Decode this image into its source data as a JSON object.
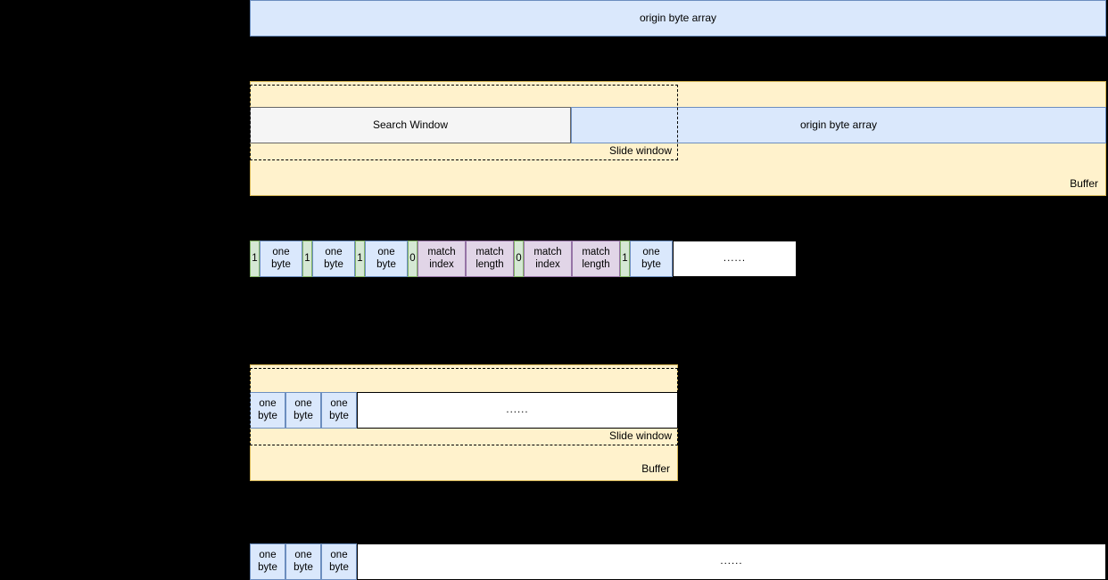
{
  "diagram": {
    "title": "LZ77 sliding window compression diagram",
    "colors": {
      "background": "#000000",
      "blue_fill": "#dae8fc",
      "blue_stroke": "#6c8ebf",
      "buffer_fill": "#fff2cc",
      "buffer_stroke": "#d6b656",
      "gray_fill": "#f5f5f5",
      "gray_stroke": "#666666",
      "purple_fill": "#e1d5e7",
      "purple_stroke": "#9673a6",
      "green_fill": "#d5e8d4",
      "green_stroke": "#82b366",
      "white_fill": "#ffffff",
      "dash_stroke": "#000000"
    }
  },
  "section1": {
    "origin_label": "origin byte array"
  },
  "section2": {
    "search_window_label": "Search Window",
    "origin_label": "origin byte array",
    "slide_window_label": "Slide window",
    "buffer_label": "Buffer"
  },
  "section3": {
    "cells": [
      {
        "kind": "flag",
        "text": "1"
      },
      {
        "kind": "byte",
        "text": "one\nbyte"
      },
      {
        "kind": "flag",
        "text": "1"
      },
      {
        "kind": "byte",
        "text": "one\nbyte"
      },
      {
        "kind": "flag",
        "text": "1"
      },
      {
        "kind": "byte",
        "text": "one\nbyte"
      },
      {
        "kind": "flag",
        "text": "0"
      },
      {
        "kind": "match",
        "text": "match\nindex"
      },
      {
        "kind": "match",
        "text": "match\nlength"
      },
      {
        "kind": "flag",
        "text": "0"
      },
      {
        "kind": "match",
        "text": "match\nindex"
      },
      {
        "kind": "match",
        "text": "match\nlength"
      },
      {
        "kind": "flag",
        "text": "1"
      },
      {
        "kind": "byte",
        "text": "one\nbyte"
      },
      {
        "kind": "tail",
        "text": "......"
      }
    ]
  },
  "section4": {
    "bytes": [
      "one\nbyte",
      "one\nbyte",
      "one\nbyte"
    ],
    "tail_text": "......",
    "slide_window_label": "Slide window",
    "buffer_label": "Buffer"
  },
  "section5": {
    "bytes": [
      "one\nbyte",
      "one\nbyte",
      "one\nbyte"
    ],
    "tail_text": "......"
  }
}
